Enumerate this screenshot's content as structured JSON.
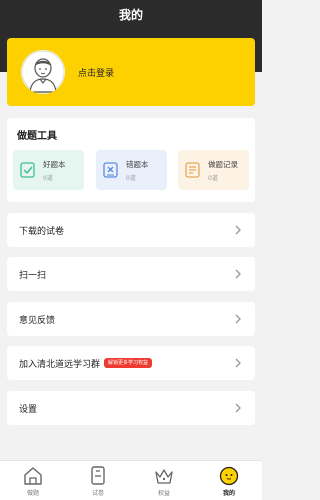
{
  "header": {
    "title": "我的"
  },
  "user": {
    "login_label": "点击登录"
  },
  "tools": {
    "title": "做题工具",
    "items": [
      {
        "label": "好题本",
        "count": "0道",
        "icon": "good-question-icon"
      },
      {
        "label": "错题本",
        "count": "0道",
        "icon": "wrong-question-icon"
      },
      {
        "label": "做题记录",
        "count": "0道",
        "icon": "record-icon"
      }
    ]
  },
  "menu": {
    "downloads": "下载的试卷",
    "scan": "扫一扫",
    "feedback": "意见反馈",
    "join_group": "加入清北道远学习群",
    "join_badge": "解锁更多学习权益",
    "settings": "设置"
  },
  "tabbar": {
    "items": [
      {
        "label": "做题",
        "icon": "home-icon"
      },
      {
        "label": "试卷",
        "icon": "paper-icon"
      },
      {
        "label": "权益",
        "icon": "crown-icon"
      },
      {
        "label": "我的",
        "icon": "profile-icon"
      }
    ],
    "active_color": "#fdd000"
  }
}
